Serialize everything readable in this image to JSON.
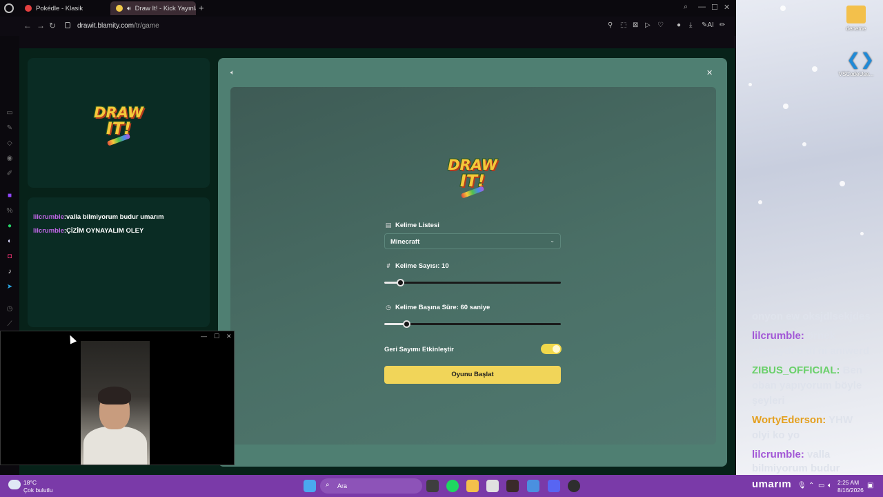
{
  "browser": {
    "tabs": [
      {
        "title": "Pokédle - Klasik",
        "active": false
      },
      {
        "title": "Draw It! - Kick Yayınları",
        "active": true
      }
    ],
    "url_host": "drawit.blamity.com",
    "url_path": "/tr/game",
    "toolbar_ai_label": "AI"
  },
  "game": {
    "logo": {
      "line1": "DRAW",
      "line2": "IT!"
    },
    "chat": [
      {
        "user": "lilcrumble",
        "sep": ":",
        "message": "valla bilmiyorum budur umarım"
      },
      {
        "user": "lilcrumble",
        "sep": ":",
        "message": "ÇİZİM OYNAYALIM OLEY"
      }
    ],
    "settings": {
      "word_list_label": "Kelime Listesi",
      "word_list_value": "Minecraft",
      "word_count_label": "Kelime Sayısı: 10",
      "word_count_fraction": 0.09,
      "time_per_word_label": "Kelime Başına Süre: 60 saniye",
      "time_per_word_fraction": 0.125,
      "countdown_label": "Geri Sayımı Etkinleştir",
      "countdown_enabled": true,
      "start_button": "Oyunu Başlat"
    },
    "accent_color": "#f1d559"
  },
  "desktop": {
    "icons": [
      {
        "label": "deneme",
        "icon": "folder-icon"
      },
      {
        "label": "VSCodeUse...",
        "icon": "vscode-icon"
      }
    ],
    "stream_chat": [
      {
        "user": "",
        "message": "onyon ew oksjdlsekjdes"
      },
      {
        "user": "lilcrumble:",
        "message": "örnek"
      },
      {
        "user": "",
        "message": "olamıydı o di ni anıwerd"
      },
      {
        "user": "ZIBUS_OFFICIAL:",
        "message": "Ben"
      },
      {
        "user": "",
        "message": "oban yapıyorum böyle"
      },
      {
        "user": "",
        "message": "şeyleri"
      },
      {
        "user": "WortyEderson:",
        "message": "YHW"
      },
      {
        "user": "",
        "message": "olyi ko yo"
      },
      {
        "user": "lilcrumble:",
        "message": "valla"
      },
      {
        "user": "",
        "message": "bilmiyorum budur"
      }
    ],
    "overlay_text": "umarım"
  },
  "taskbar": {
    "weather_temp": "18°C",
    "weather_desc": "Çok bulutlu",
    "search_placeholder": "Ara",
    "time": "2:25 AM",
    "date": "8/16/2026"
  }
}
